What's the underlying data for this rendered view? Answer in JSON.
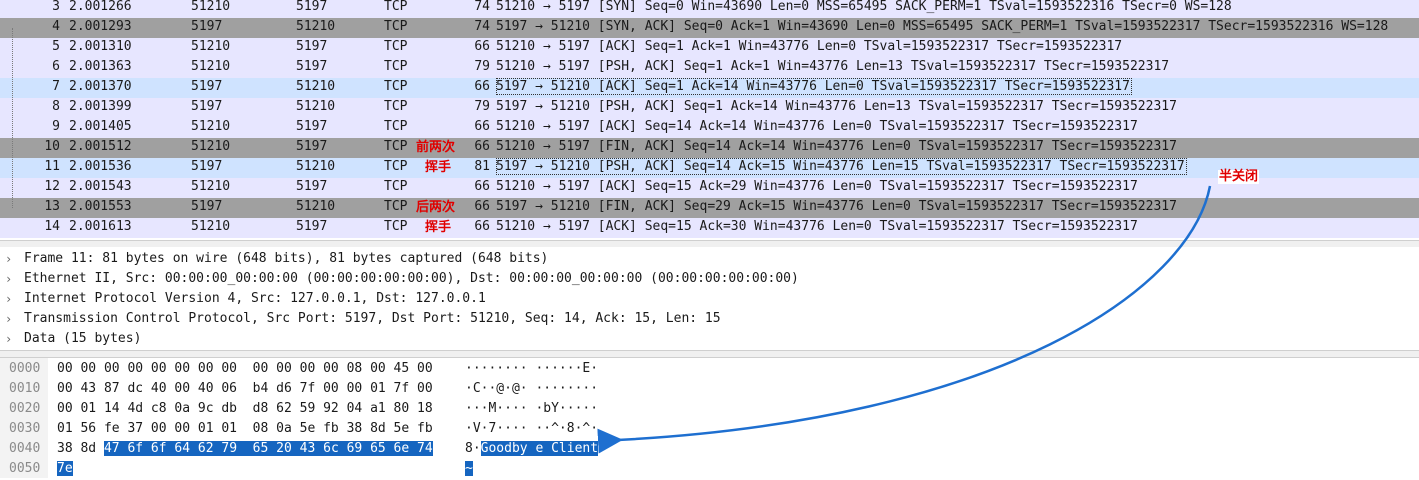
{
  "packets": [
    {
      "no": "3",
      "time": "2.001266",
      "src": "51210",
      "dst": "5197",
      "proto": "TCP",
      "len": "74",
      "info": "51210 → 5197 [SYN] Seq=0 Win=43690 Len=0 MSS=65495 SACK_PERM=1 TSval=1593522316 TSecr=0 WS=128",
      "style": "lav"
    },
    {
      "no": "4",
      "time": "2.001293",
      "src": "5197",
      "dst": "51210",
      "proto": "TCP",
      "len": "74",
      "info": "5197 → 51210 [SYN, ACK] Seq=0 Ack=1 Win=43690 Len=0 MSS=65495 SACK_PERM=1 TSval=1593522317 TSecr=1593522316 WS=128",
      "style": "dark"
    },
    {
      "no": "5",
      "time": "2.001310",
      "src": "51210",
      "dst": "5197",
      "proto": "TCP",
      "len": "66",
      "info": "51210 → 5197 [ACK] Seq=1 Ack=1 Win=43776 Len=0 TSval=1593522317 TSecr=1593522317",
      "style": "lav"
    },
    {
      "no": "6",
      "time": "2.001363",
      "src": "51210",
      "dst": "5197",
      "proto": "TCP",
      "len": "79",
      "info": "51210 → 5197 [PSH, ACK] Seq=1 Ack=1 Win=43776 Len=13 TSval=1593522317 TSecr=1593522317",
      "style": "lav"
    },
    {
      "no": "7",
      "time": "2.001370",
      "src": "5197",
      "dst": "51210",
      "proto": "TCP",
      "len": "66",
      "info": "5197 → 51210 [ACK] Seq=1 Ack=14 Win=43776 Len=0 TSval=1593522317 TSecr=1593522317",
      "style": "sel"
    },
    {
      "no": "8",
      "time": "2.001399",
      "src": "5197",
      "dst": "51210",
      "proto": "TCP",
      "len": "79",
      "info": "5197 → 51210 [PSH, ACK] Seq=1 Ack=14 Win=43776 Len=13 TSval=1593522317 TSecr=1593522317",
      "style": "lav"
    },
    {
      "no": "9",
      "time": "2.001405",
      "src": "51210",
      "dst": "5197",
      "proto": "TCP",
      "len": "66",
      "info": "51210 → 5197 [ACK] Seq=14 Ack=14 Win=43776 Len=0 TSval=1593522317 TSecr=1593522317",
      "style": "lav"
    },
    {
      "no": "10",
      "time": "2.001512",
      "src": "51210",
      "dst": "5197",
      "proto": "TCP",
      "len": "66",
      "info": "51210 → 5197 [FIN, ACK] Seq=14 Ack=14 Win=43776 Len=0 TSval=1593522317 TSecr=1593522317",
      "style": "dark"
    },
    {
      "no": "11",
      "time": "2.001536",
      "src": "5197",
      "dst": "51210",
      "proto": "TCP",
      "len": "81",
      "info": "5197 → 51210 [PSH, ACK] Seq=14 Ack=15 Win=43776 Len=15 TSval=1593522317 TSecr=1593522317",
      "style": "sel"
    },
    {
      "no": "12",
      "time": "2.001543",
      "src": "51210",
      "dst": "5197",
      "proto": "TCP",
      "len": "66",
      "info": "51210 → 5197 [ACK] Seq=15 Ack=29 Win=43776 Len=0 TSval=1593522317 TSecr=1593522317",
      "style": "lav"
    },
    {
      "no": "13",
      "time": "2.001553",
      "src": "5197",
      "dst": "51210",
      "proto": "TCP",
      "len": "66",
      "info": "5197 → 51210 [FIN, ACK] Seq=29 Ack=15 Win=43776 Len=0 TSval=1593522317 TSecr=1593522317",
      "style": "dark"
    },
    {
      "no": "14",
      "time": "2.001613",
      "src": "51210",
      "dst": "5197",
      "proto": "TCP",
      "len": "66",
      "info": "51210 → 5197 [ACK] Seq=15 Ack=30 Win=43776 Len=0 TSval=1593522317 TSecr=1593522317",
      "style": "lav"
    }
  ],
  "details": [
    "Frame 11: 81 bytes on wire (648 bits), 81 bytes captured (648 bits)",
    "Ethernet II, Src: 00:00:00_00:00:00 (00:00:00:00:00:00), Dst: 00:00:00_00:00:00 (00:00:00:00:00:00)",
    "Internet Protocol Version 4, Src: 127.0.0.1, Dst: 127.0.0.1",
    "Transmission Control Protocol, Src Port: 5197, Dst Port: 51210, Seq: 14, Ack: 15, Len: 15",
    "Data (15 bytes)"
  ],
  "bytes": [
    {
      "off": "0000",
      "hex": "00 00 00 00 00 00 00 00  00 00 00 00 08 00 45 00",
      "hex_hl": "",
      "asc": "········ ······E·",
      "asc_hl": ""
    },
    {
      "off": "0010",
      "hex": "00 43 87 dc 40 00 40 06  b4 d6 7f 00 00 01 7f 00",
      "hex_hl": "",
      "asc": "·C··@·@· ········",
      "asc_hl": ""
    },
    {
      "off": "0020",
      "hex": "00 01 14 4d c8 0a 9c db  d8 62 59 92 04 a1 80 18",
      "hex_hl": "",
      "asc": "···M···· ·bY·····",
      "asc_hl": ""
    },
    {
      "off": "0030",
      "hex": "01 56 fe 37 00 00 01 01  08 0a 5e fb 38 8d 5e fb",
      "hex_hl": "",
      "asc": "·V·7···· ··^·8·^·",
      "asc_hl": ""
    },
    {
      "off": "0040",
      "hex": "38 8d ",
      "hex_hl": "47 6f 6f 64 62 79  65 20 43 6c 69 65 6e 74",
      "asc": "8·",
      "asc_hl": "Goodby e Client"
    },
    {
      "off": "0050",
      "hex": "",
      "hex_hl": "7e",
      "asc": "",
      "asc_hl": "~"
    }
  ],
  "annotations": {
    "first_two_a": "前两次",
    "first_two_b": "挥手",
    "last_two_a": "后两次",
    "last_two_b": "挥手",
    "half_close": "半关闭"
  },
  "colors": {
    "accent_arrow": "#1e6fd0",
    "annotation": "#e00000",
    "highlight": "#1565c0"
  }
}
